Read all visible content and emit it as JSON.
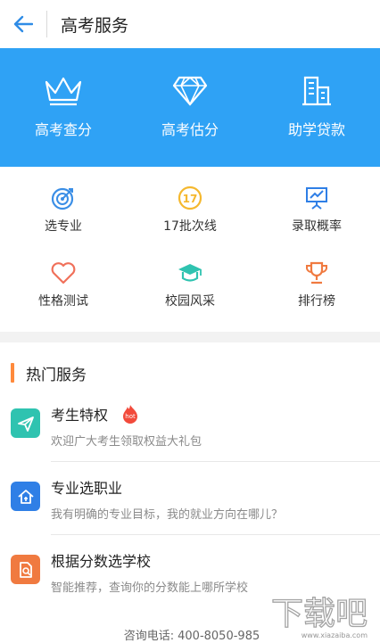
{
  "header": {
    "title": "高考服务"
  },
  "banner": {
    "items": [
      {
        "label": "高考查分",
        "icon": "crown-icon"
      },
      {
        "label": "高考估分",
        "icon": "diamond-icon"
      },
      {
        "label": "助学贷款",
        "icon": "building-icon"
      }
    ]
  },
  "grid": {
    "items": [
      {
        "label": "选专业",
        "icon": "target-icon",
        "color": "#3a8ee6"
      },
      {
        "label": "17批次线",
        "icon": "badge-17-icon",
        "color": "#f5b82e"
      },
      {
        "label": "录取概率",
        "icon": "chart-board-icon",
        "color": "#2fa2f5"
      },
      {
        "label": "性格测试",
        "icon": "heart-icon",
        "color": "#f0705a"
      },
      {
        "label": "校园风采",
        "icon": "graduation-cap-icon",
        "color": "#2fc3b0"
      },
      {
        "label": "排行榜",
        "icon": "trophy-icon",
        "color": "#f07a40"
      }
    ]
  },
  "hot": {
    "title": "热门服务",
    "items": [
      {
        "title": "考生特权",
        "desc": "欢迎广大考生领取权益大礼包",
        "badge": "hot",
        "icon": "paper-plane-icon",
        "color": "#2fc3b0"
      },
      {
        "title": "专业选职业",
        "desc": "我有明确的专业目标，我的就业方向在哪儿？",
        "icon": "house-icon",
        "color": "#2f7fe6"
      },
      {
        "title": "根据分数选学校",
        "desc": "智能推荐，查询你的分数能上哪所学校",
        "icon": "doc-search-icon",
        "color": "#f07a40"
      }
    ]
  },
  "footer": {
    "label": "咨询电话:",
    "phone": "400-8050-985"
  },
  "watermark": {
    "text": "下载吧",
    "url": "www.xiazaiba.com"
  }
}
